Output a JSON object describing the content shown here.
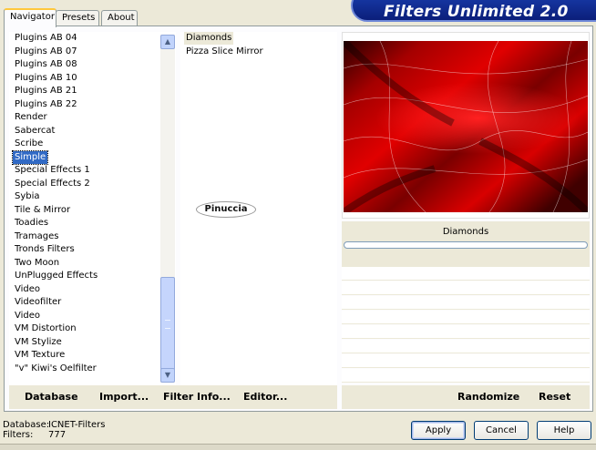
{
  "title": "Filters Unlimited 2.0",
  "tabs": [
    {
      "label": "Navigator",
      "active": true
    },
    {
      "label": "Presets",
      "active": false
    },
    {
      "label": "About",
      "active": false
    }
  ],
  "categories": [
    "Plugins AB 04",
    "Plugins AB 07",
    "Plugins AB 08",
    "Plugins AB 10",
    "Plugins AB 21",
    "Plugins AB 22",
    "Render",
    "Sabercat",
    "Scribe",
    "Simple",
    "Special Effects 1",
    "Special Effects 2",
    "Sybia",
    "Tile & Mirror",
    "Toadies",
    "Tramages",
    "Tronds Filters",
    "Two Moon",
    "UnPlugged Effects",
    "Video",
    "Videofilter",
    "Video",
    "VM Distortion",
    "VM Stylize",
    "VM Texture",
    "\"v\" Kiwi's Oelfilter"
  ],
  "selected_category": "Simple",
  "filters": [
    "Diamonds",
    "Pizza Slice Mirror"
  ],
  "selected_filter": "Diamonds",
  "signature_text": "Pinuccia",
  "parameter_name": "Diamonds",
  "left_toolbar": {
    "database": "Database",
    "import": "Import...",
    "filter_info": "Filter Info...",
    "editor": "Editor..."
  },
  "right_toolbar": {
    "randomize": "Randomize",
    "reset": "Reset"
  },
  "status": {
    "database_label": "Database:",
    "database_value": "ICNET-Filters",
    "filters_label": "Filters:",
    "filters_value": "777"
  },
  "buttons": {
    "apply": "Apply",
    "cancel": "Cancel",
    "help": "Help"
  },
  "icons": {
    "scroll_up": "chevron-up-icon",
    "scroll_down": "chevron-down-icon"
  }
}
